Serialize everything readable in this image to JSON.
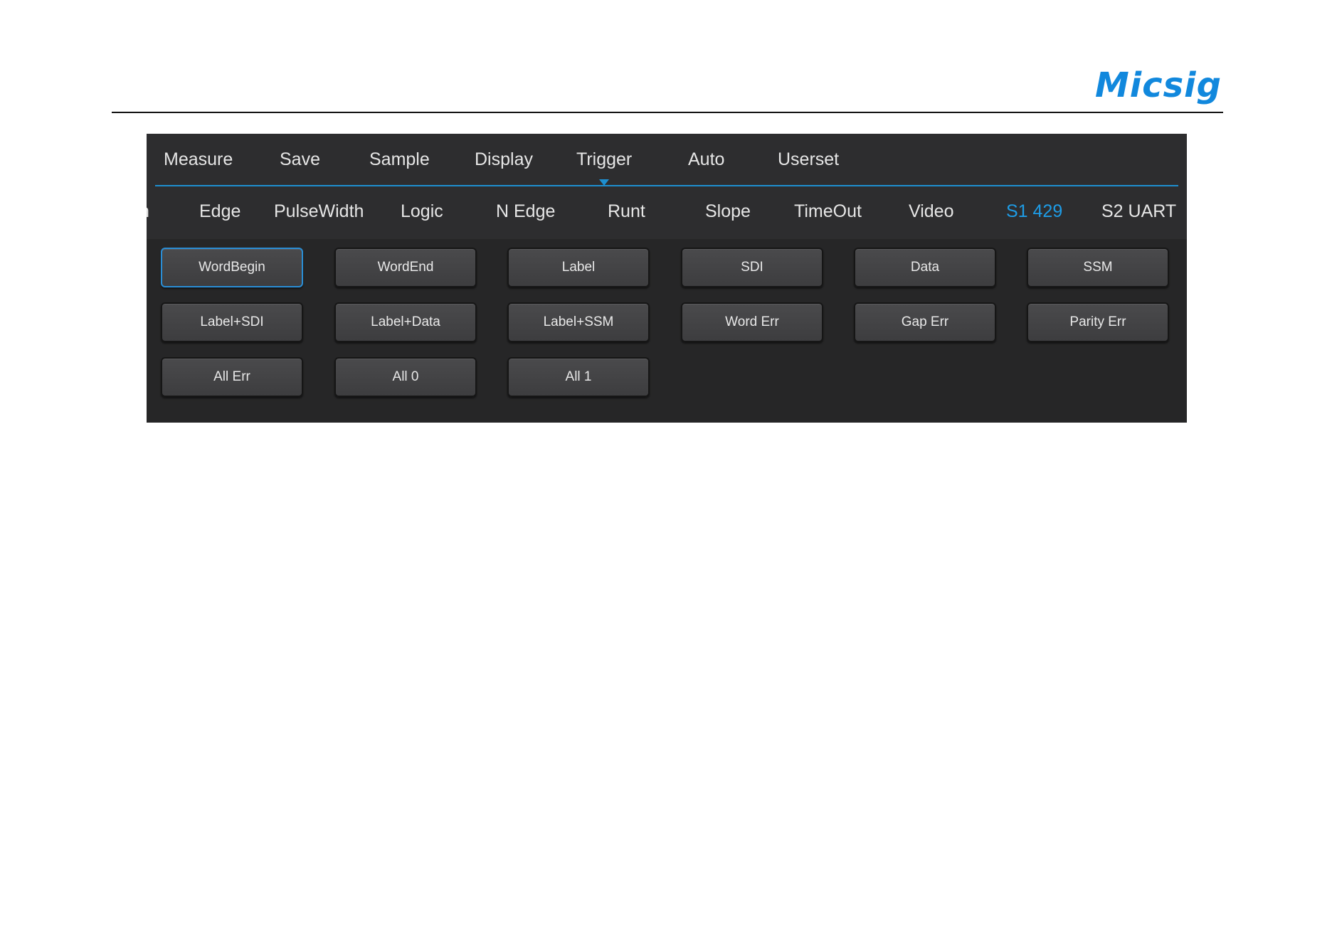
{
  "brand": {
    "logo_text": "Micsig"
  },
  "menu": {
    "items": [
      "Measure",
      "Save",
      "Sample",
      "Display",
      "Trigger",
      "Auto",
      "Userset"
    ],
    "active": "Trigger"
  },
  "submenu": {
    "clipped_fragment": "n",
    "items": [
      "Edge",
      "PulseWidth",
      "Logic",
      "N Edge",
      "Runt",
      "Slope",
      "TimeOut",
      "Video",
      "S1 429",
      "S2 UART"
    ],
    "active": "S1 429"
  },
  "options": {
    "selected": "WordBegin",
    "buttons": [
      "WordBegin",
      "WordEnd",
      "Label",
      "SDI",
      "Data",
      "SSM",
      "Label+SDI",
      "Label+Data",
      "Label+SSM",
      "Word Err",
      "Gap Err",
      "Parity Err",
      "All Err",
      "All 0",
      "All 1"
    ]
  },
  "colors": {
    "accent": "#1e8fd0",
    "active_text": "#1e9ce6",
    "panel_bg": "#2d2d2f",
    "button_area_bg": "#262627",
    "logo": "#1188dd"
  }
}
